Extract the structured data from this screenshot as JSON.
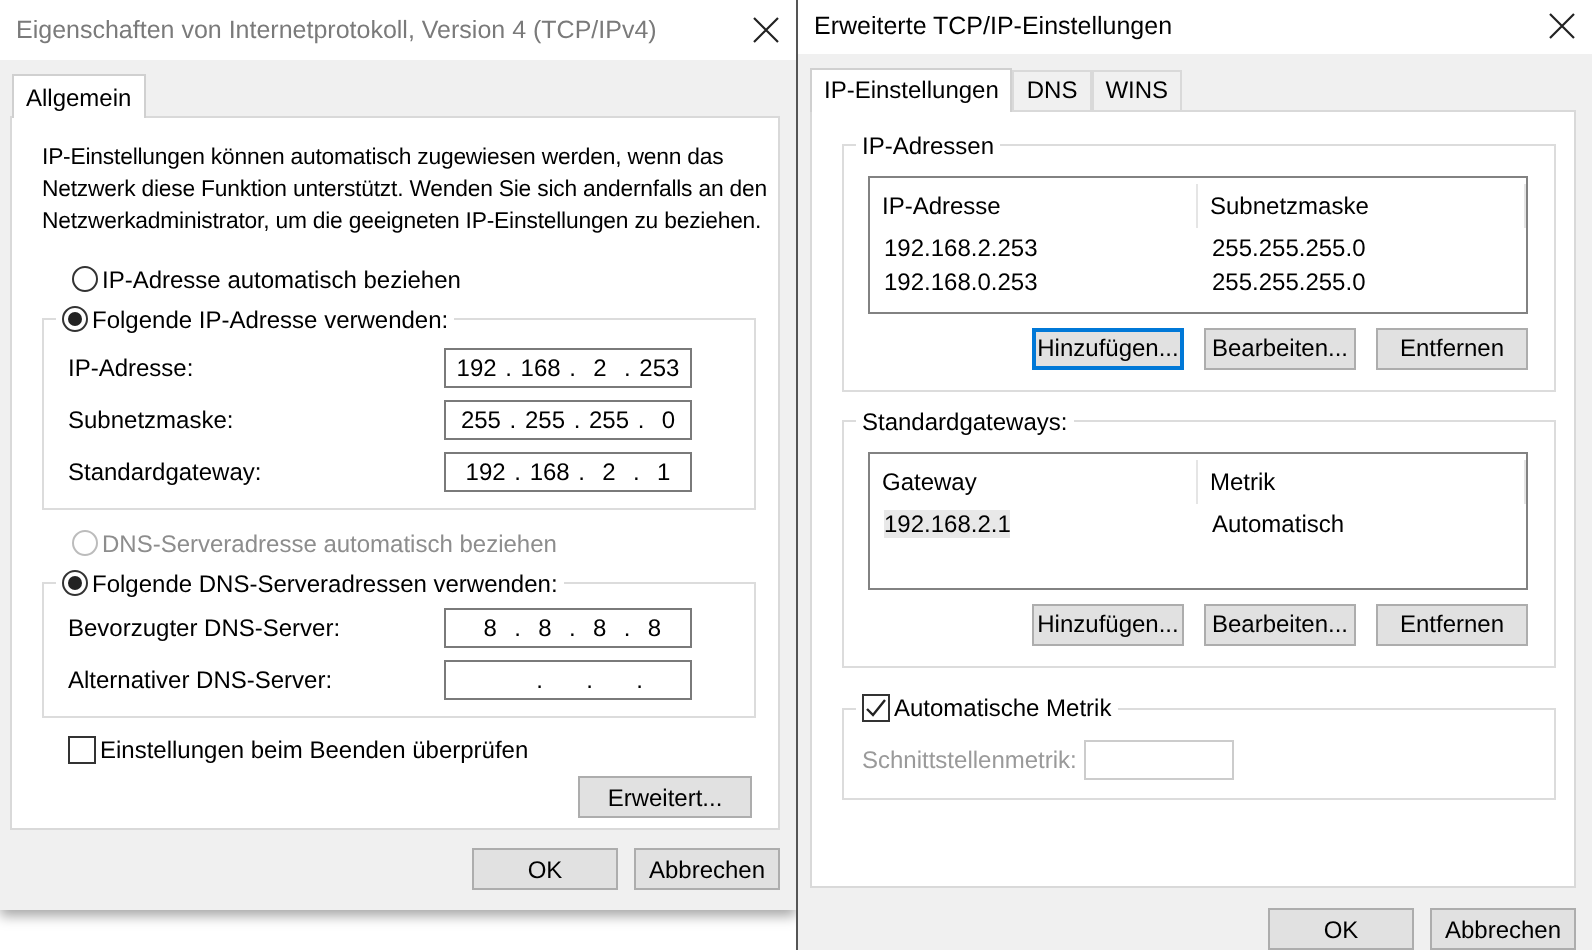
{
  "ipv4_dialog": {
    "title": "Eigenschaften von Internetprotokoll, Version 4 (TCP/IPv4)",
    "active": false,
    "tabs": [
      {
        "label": "Allgemein",
        "selected": true
      }
    ],
    "intro": "IP-Einstellungen können automatisch zugewiesen werden, wenn das Netzwerk diese Funktion unterstützt. Wenden Sie sich andernfalls an den Netzwerkadministrator, um die geeigneten IP-Einstellungen zu beziehen.",
    "ip_options": [
      {
        "label": "IP-Adresse automatisch beziehen",
        "selected": false,
        "disabled": false
      },
      {
        "label": "Folgende IP-Adresse verwenden:",
        "selected": true,
        "disabled": false
      }
    ],
    "ip_fields": [
      {
        "label": "IP-Adresse:",
        "value": "192 . 168 .  2  . 253"
      },
      {
        "label": "Subnetzmaske:",
        "value": "255 . 255 . 255 .  0"
      },
      {
        "label": "Standardgateway:",
        "value": "192 . 168 .  2  .  1"
      }
    ],
    "dns_options": [
      {
        "label": "DNS-Serveradresse automatisch beziehen",
        "selected": false,
        "disabled": true
      },
      {
        "label": "Folgende DNS-Serveradressen verwenden:",
        "selected": true,
        "disabled": false
      }
    ],
    "dns_fields": [
      {
        "label": "Bevorzugter DNS-Server:",
        "value": " 8  .  8  .  8  .  8"
      },
      {
        "label": "Alternativer DNS-Server:",
        "value": "     .     .     ."
      }
    ],
    "validate_on_exit": {
      "label": "Einstellungen beim Beenden überprüfen",
      "checked": false
    },
    "advanced_button": "Erweitert...",
    "buttons": [
      "OK",
      "Abbrechen"
    ]
  },
  "advanced_dialog": {
    "title": "Erweiterte TCP/IP-Einstellungen",
    "active": true,
    "tabs": [
      {
        "label": "IP-Einstellungen",
        "selected": true
      },
      {
        "label": "DNS",
        "selected": false
      },
      {
        "label": "WINS",
        "selected": false
      }
    ],
    "ip_addresses": {
      "title": "IP-Adressen",
      "columns": [
        "IP-Adresse",
        "Subnetzmaske"
      ],
      "rows": [
        {
          "cells": [
            "192.168.2.253",
            "255.255.255.0"
          ],
          "selected": false
        },
        {
          "cells": [
            "192.168.0.253",
            "255.255.255.0"
          ],
          "selected": false
        }
      ],
      "buttons": [
        {
          "label": "Hinzufügen...",
          "focused": true
        },
        {
          "label": "Bearbeiten...",
          "focused": false
        },
        {
          "label": "Entfernen",
          "focused": false
        }
      ]
    },
    "gateways": {
      "title": "Standardgateways:",
      "columns": [
        "Gateway",
        "Metrik"
      ],
      "rows": [
        {
          "cells": [
            "192.168.2.1",
            "Automatisch"
          ],
          "selected": true
        }
      ],
      "buttons": [
        {
          "label": "Hinzufügen...",
          "focused": false
        },
        {
          "label": "Bearbeiten...",
          "focused": false
        },
        {
          "label": "Entfernen",
          "focused": false
        }
      ]
    },
    "auto_metric": {
      "label": "Automatische Metrik",
      "checked": true
    },
    "interface_metric": {
      "label": "Schnittstellenmetrik:",
      "disabled": true
    },
    "buttons": [
      "OK",
      "Abbrechen"
    ]
  }
}
